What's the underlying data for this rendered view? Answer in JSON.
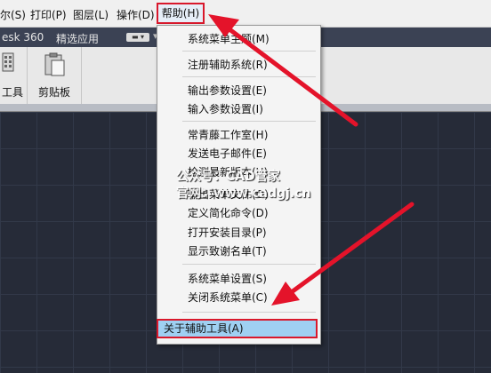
{
  "menubar": {
    "items": [
      "尔(S)",
      "打印(P)",
      "图层(L)",
      "操作(D)"
    ],
    "help": "帮助(H)"
  },
  "tabstrip": {
    "app": "esk 360",
    "featured": "精选应用"
  },
  "ribbon": {
    "tools_label": "工具",
    "clipboard_label": "剪贴板"
  },
  "help_menu": {
    "items": [
      "系统菜单主题(M)",
      "注册辅助系统(R)",
      "输出参数设置(E)",
      "输入参数设置(I)",
      "常青藤工作室(H)",
      "发送电子邮件(E)",
      "检测最新版本(U)",
      "输出菜单文件(O)",
      "定义简化命令(D)",
      "打开安装目录(P)",
      "显示致谢名单(T)",
      "系统菜单设置(S)",
      "关闭系统菜单(C)"
    ],
    "highlighted_item": "关于辅助工具(A)"
  },
  "watermark": {
    "line1": "公众号：CAD管家",
    "line2": "官网：www.cadgj.cn"
  },
  "colors": {
    "highlight_border": "#d9182b",
    "highlight_fill": "#9fd0f2",
    "arrow": "#e4132a"
  }
}
